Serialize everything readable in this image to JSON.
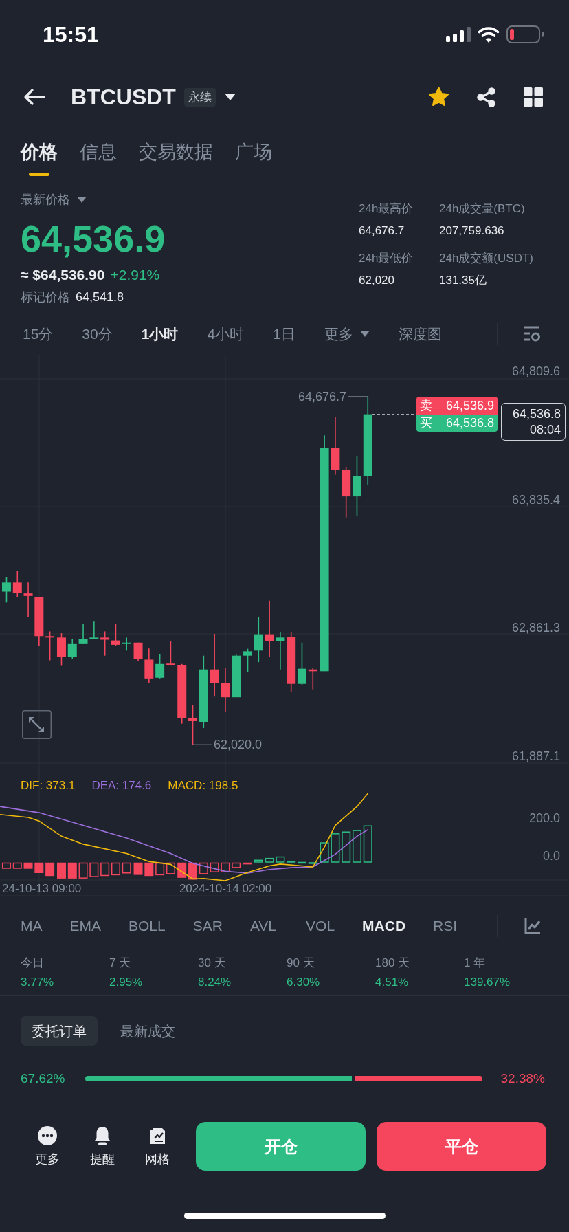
{
  "status_bar": {
    "time": "15:51"
  },
  "header": {
    "symbol": "BTCUSDT",
    "contract_type": "永续",
    "favorited": true
  },
  "tabs": [
    {
      "label": "价格",
      "selected": true
    },
    {
      "label": "信息",
      "selected": false
    },
    {
      "label": "交易数据",
      "selected": false
    },
    {
      "label": "广场",
      "selected": false
    }
  ],
  "price_summary": {
    "label": "最新价格",
    "last_price": "64,536.9",
    "usd_value": "≈ $64,536.90",
    "change": "+2.91%",
    "mark_price_label": "标记价格",
    "mark_price": "64,541.8"
  },
  "stats_24h": [
    {
      "label": "24h最高价",
      "value": "64,676.7"
    },
    {
      "label": "24h成交量(BTC)",
      "value": "207,759.636"
    },
    {
      "label": "24h最低价",
      "value": "62,020"
    },
    {
      "label": "24h成交额(USDT)",
      "value": "131.35亿"
    }
  ],
  "intervals": [
    {
      "label": "15分",
      "selected": false
    },
    {
      "label": "30分",
      "selected": false
    },
    {
      "label": "1小时",
      "selected": true
    },
    {
      "label": "4小时",
      "selected": false
    },
    {
      "label": "1日",
      "selected": false
    }
  ],
  "more_intervals": {
    "label": "更多"
  },
  "depth_chart": {
    "label": "深度图",
    "selected": false
  },
  "chart": {
    "price_ticks": [
      "64,809.6",
      "63,835.4",
      "62,861.3",
      "61,887.1"
    ],
    "high_label": "64,676.7",
    "low_label": "62,020.0",
    "ask": {
      "side": "卖",
      "price": "64,536.9"
    },
    "bid": {
      "side": "买",
      "price": "64,536.8"
    },
    "last_price": "64,536.8",
    "countdown": "08:04"
  },
  "macd": {
    "legend": [
      {
        "label": "DIF: 373.1",
        "color": "#f0b90b"
      },
      {
        "label": "DEA: 174.6",
        "color": "#9d6fdc"
      },
      {
        "label": "MACD: 198.5",
        "color": "#f0b90b"
      }
    ],
    "ticks": [
      "200.0",
      "0.0"
    ]
  },
  "time_axis": [
    "24-10-13 09:00",
    "2024-10-14 02:00"
  ],
  "main_indicators": [
    {
      "label": "MA",
      "selected": false
    },
    {
      "label": "EMA",
      "selected": false
    },
    {
      "label": "BOLL",
      "selected": false
    },
    {
      "label": "SAR",
      "selected": false
    },
    {
      "label": "AVL",
      "selected": false
    }
  ],
  "sub_indicators": [
    {
      "label": "VOL",
      "selected": false
    },
    {
      "label": "MACD",
      "selected": true
    },
    {
      "label": "RSI",
      "selected": false
    }
  ],
  "returns": [
    {
      "period": "今日",
      "value": "3.77%"
    },
    {
      "period": "7 天",
      "value": "2.95%"
    },
    {
      "period": "30 天",
      "value": "8.24%"
    },
    {
      "period": "90 天",
      "value": "6.30%"
    },
    {
      "period": "180 天",
      "value": "4.51%"
    },
    {
      "period": "1 年",
      "value": "139.67%"
    }
  ],
  "order_tabs": [
    {
      "label": "委托订单",
      "selected": true
    },
    {
      "label": "最新成交",
      "selected": false
    }
  ],
  "order_ratio": {
    "buy_share": "67.62%",
    "sell_share": "32.38%",
    "level": 0.6762
  },
  "bottom_actions": [
    {
      "label": "更多",
      "kind": "more"
    },
    {
      "label": "提醒",
      "kind": "alert"
    },
    {
      "label": "网格",
      "kind": "grid"
    }
  ],
  "trade_buttons": [
    {
      "label": "开仓",
      "kind": "open"
    },
    {
      "label": "平仓",
      "kind": "close"
    }
  ]
}
